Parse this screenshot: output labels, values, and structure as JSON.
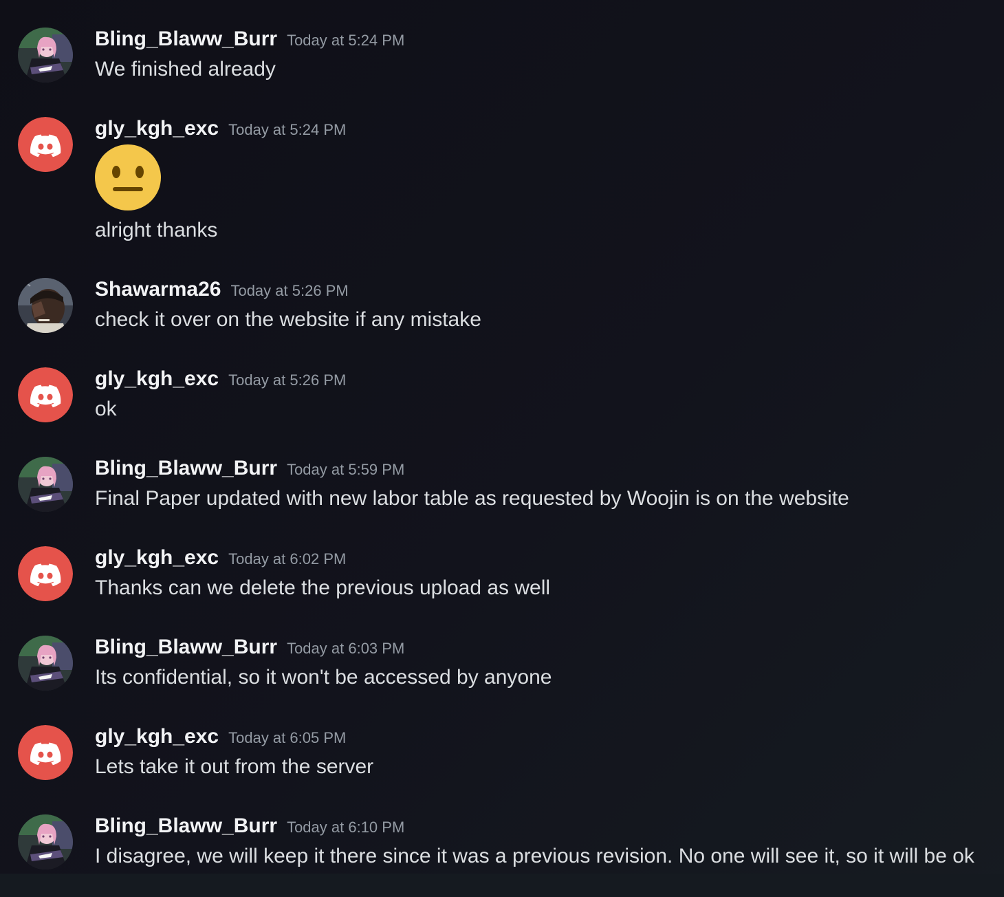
{
  "messages": [
    {
      "author": "Bling_Blaww_Burr",
      "timestamp": "Today at 5:24 PM",
      "text": "We finished already",
      "avatar": "anime-girl-avatar"
    },
    {
      "author": "gly_kgh_exc",
      "timestamp": "Today at 5:24 PM",
      "emoji": "neutral-face-emoji",
      "text": "alright thanks",
      "avatar": "discord-default-avatar"
    },
    {
      "author": "Shawarma26",
      "timestamp": "Today at 5:26 PM",
      "text": "check it over on the website if any mistake",
      "avatar": "man-smoking-avatar"
    },
    {
      "author": "gly_kgh_exc",
      "timestamp": "Today at 5:26 PM",
      "text": "ok",
      "avatar": "discord-default-avatar"
    },
    {
      "author": "Bling_Blaww_Burr",
      "timestamp": "Today at 5:59 PM",
      "text": "Final Paper updated with new labor table as requested by Woojin is on the website",
      "avatar": "anime-girl-avatar"
    },
    {
      "author": "gly_kgh_exc",
      "timestamp": "Today at 6:02 PM",
      "text": "Thanks can we delete the previous upload as well",
      "avatar": "discord-default-avatar"
    },
    {
      "author": "Bling_Blaww_Burr",
      "timestamp": "Today at 6:03 PM",
      "text": "Its confidential, so it won't be accessed by anyone",
      "avatar": "anime-girl-avatar"
    },
    {
      "author": "gly_kgh_exc",
      "timestamp": "Today at 6:05 PM",
      "text": "Lets take it out from the server",
      "avatar": "discord-default-avatar"
    },
    {
      "author": "Bling_Blaww_Burr",
      "timestamp": "Today at 6:10 PM",
      "text": "I disagree, we will keep it there since it was a previous revision. No one will see it, so it will be ok",
      "avatar": "anime-girl-avatar"
    }
  ],
  "colors": {
    "background": "#12131c",
    "username": "#f2f3f5",
    "timestamp": "#949ba4",
    "message_text": "#dbdee1",
    "discord_red": "#e5534b",
    "emoji_yellow": "#f4c74b"
  }
}
